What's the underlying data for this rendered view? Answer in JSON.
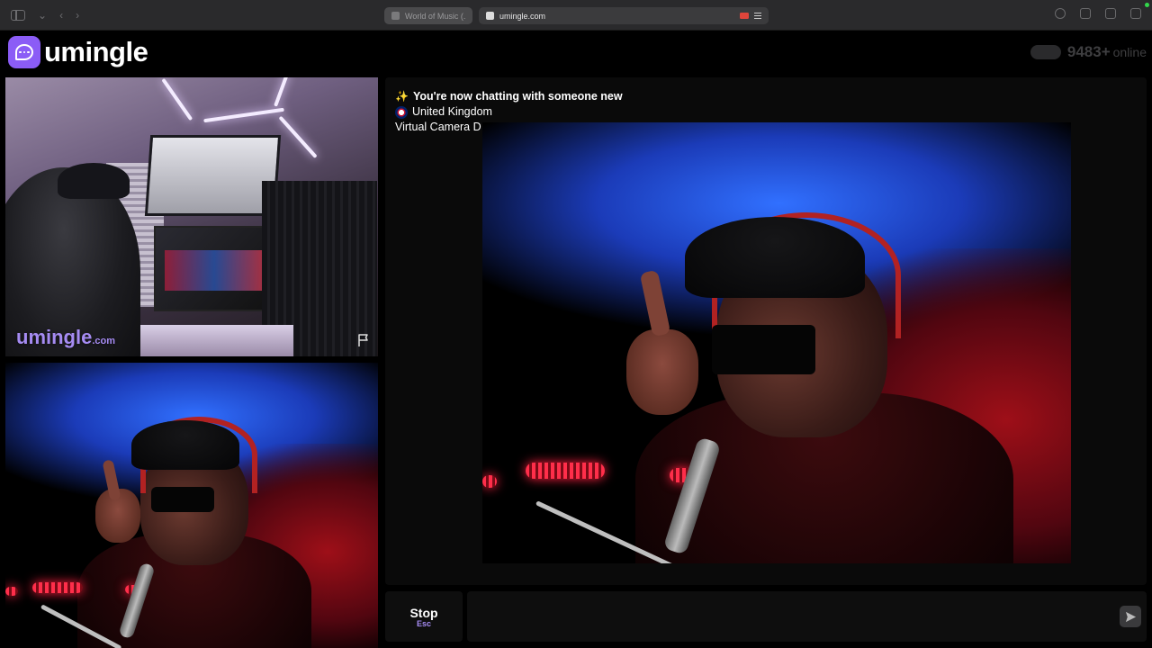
{
  "browser": {
    "tabs": [
      {
        "title": "World of Music (...",
        "active": false
      },
      {
        "title": "umingle.com",
        "active": true
      }
    ]
  },
  "header": {
    "logo_text": "umingle",
    "online_count": "9483+",
    "online_label": "online"
  },
  "self_view": {
    "brand": "umingle",
    "brand_suffix": ".com"
  },
  "chat": {
    "intro": "You're now chatting with someone new",
    "country": "United Kingdom",
    "device": "Virtual Camera D"
  },
  "controls": {
    "stop_label": "Stop",
    "stop_shortcut": "Esc",
    "message_placeholder": ""
  },
  "colors": {
    "accent": "#8b5cf6",
    "brand_text": "#a58bf2",
    "background": "#000000"
  }
}
